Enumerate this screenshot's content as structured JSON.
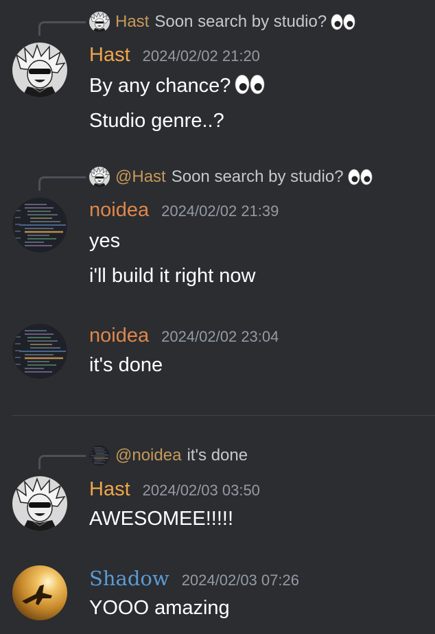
{
  "colors": {
    "hast": "#f0a64a",
    "noidea": "#e0874a",
    "shadow": "#5b9bd5",
    "reply_mention": "#c79a5a"
  },
  "messages": [
    {
      "reply": {
        "name": "Hast",
        "text": "Soon search by studio?",
        "emoji": "eyes-emoji"
      },
      "author": "Hast",
      "timestamp": "2024/02/02 21:20",
      "lines": [
        "By any chance?",
        "Studio genre..?"
      ]
    },
    {
      "reply": {
        "name": "@Hast",
        "text": "Soon search by studio?",
        "emoji": "eyes-emoji"
      },
      "author": "noidea",
      "timestamp": "2024/02/02 21:39",
      "lines": [
        "yes",
        "i'll build it right now"
      ]
    },
    {
      "author": "noidea",
      "timestamp": "2024/02/02 23:04",
      "lines": [
        "it's done"
      ]
    },
    {
      "reply": {
        "name": "@noidea",
        "text": "it's done"
      },
      "author": "Hast",
      "timestamp": "2024/02/03 03:50",
      "lines": [
        "AWESOMEE!!!!!"
      ]
    },
    {
      "author": "Shadow",
      "timestamp": "2024/02/03 07:26",
      "lines": [
        "YOOO amazing"
      ]
    }
  ]
}
